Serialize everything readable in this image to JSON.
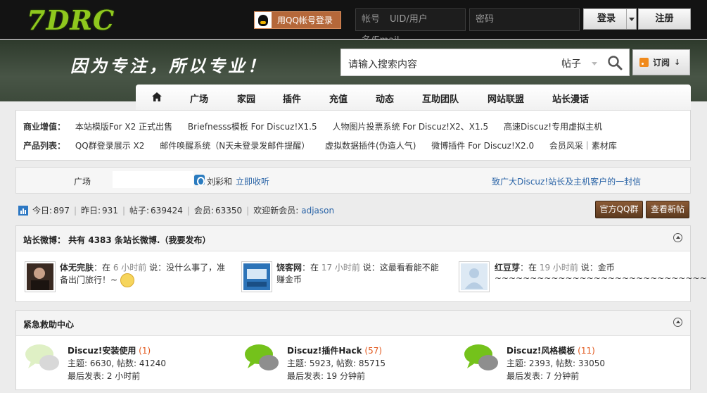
{
  "logo": "7DRC",
  "header": {
    "qq_login": "用QQ帐号登录",
    "account_label": "帐号",
    "account_placeholder": "UID/用户名/Email",
    "password_placeholder": "密码",
    "login": "登录",
    "register": "注册"
  },
  "banner": {
    "slogan": "因为专注，所以专业！",
    "search_placeholder": "请输入搜索内容",
    "search_scope": "帖子",
    "rss": "订阅"
  },
  "nav": {
    "items": [
      "广场",
      "家园",
      "插件",
      "充值",
      "动态",
      "互助团队",
      "网站联盟",
      "站长漫话"
    ]
  },
  "links": {
    "row1_label": "商业增值：",
    "row1": [
      "本站模版For X2 正式出售",
      "Briefnesss模板 For Discuz!X1.5",
      "人物图片投票系统 For Discuz!X2、X1.5",
      "高速Discuz!专用虚拟主机"
    ],
    "row2_label": "产品列表：",
    "row2": [
      "QQ群登录展示 X2",
      "邮件唤醒系统（N天未登录发邮件提醒）",
      "虚拟数据插件(伪造人气)",
      "微博插件 For Discuz!X2.0",
      "会员风采｜素材库"
    ]
  },
  "breadcrumb": {
    "home": "广场",
    "who": "刘彩和",
    "listen": "立即收听",
    "letter": "致广大Discuz!站长及主机客户的一封信"
  },
  "stats": {
    "today_label": "今日:",
    "today": "897",
    "yesterday_label": "昨日:",
    "yesterday": "931",
    "posts_label": "帖子:",
    "posts": "639424",
    "members_label": "会员:",
    "members": "63350",
    "welcome_label": "欢迎新会员:",
    "new_member": "adjason",
    "qq_group": "官方QQ群",
    "new_posts": "查看新帖"
  },
  "weibo": {
    "title": "站长微博： 共有 4383 条站长微博.（我要发布）",
    "items": [
      {
        "user": "体无完肤",
        "prefix": "：在 ",
        "time": "6 小时前",
        "text": " 说：没什么事了，准备出门旅行！~"
      },
      {
        "user": "饶客网",
        "prefix": "：在 ",
        "time": "17 小时前",
        "text": " 说：这最看看能不能赚金币"
      },
      {
        "user": "红豆芽",
        "prefix": "：在 ",
        "time": "19 小时前",
        "text": " 说：金币~~~~~~~~~~~~~~~~~~~~~~~~~~~~~~"
      }
    ]
  },
  "help": {
    "title": "紧急救助中心",
    "forums": [
      {
        "name": "Discuz!安装使用",
        "count": "(1)",
        "stats": "主题: 6630, 帖数: 41240",
        "last": "最后发表: 2 小时前"
      },
      {
        "name": "Discuz!插件Hack",
        "count": "(57)",
        "stats": "主题: 5923, 帖数: 85715",
        "last": "最后发表: 19 分钟前"
      },
      {
        "name": "Discuz!风格模板",
        "count": "(11)",
        "stats": "主题: 2393, 帖数: 33050",
        "last": "最后发表: 7 分钟前"
      }
    ]
  },
  "colors": {
    "accent_green": "#8fc81e",
    "link_blue": "#2963a6",
    "count_orange": "#e2581d",
    "brown_button": "#6f4628"
  }
}
